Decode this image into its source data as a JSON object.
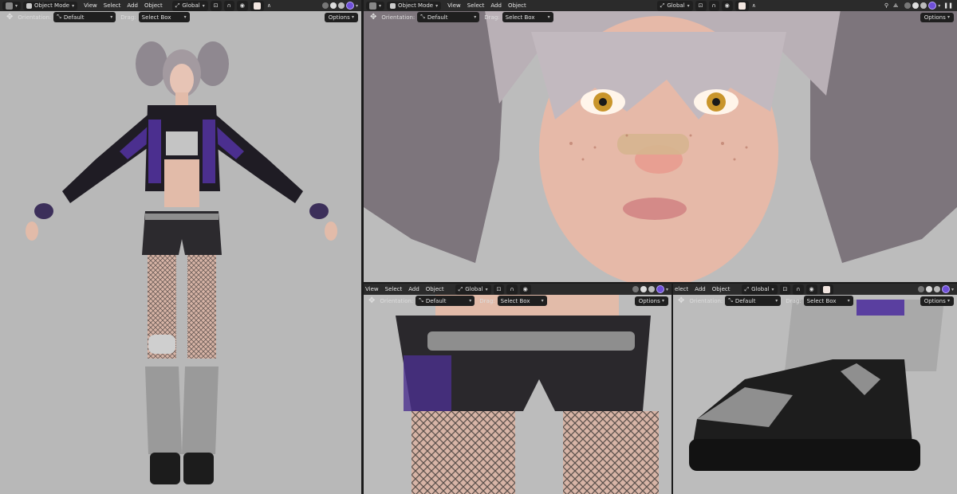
{
  "viewport_top": {
    "mode": "Object Mode",
    "menus": [
      "View",
      "Select",
      "Add",
      "Object"
    ],
    "transform": "Global",
    "orientation_label": "Orientation:",
    "orientation_value": "Default",
    "drag_label": "Drag:",
    "drag_value": "Select Box",
    "options": "Options"
  },
  "viewport_partial": {
    "menus_bl": [
      "View",
      "Select",
      "Add",
      "Object"
    ],
    "menus_br": [
      "elect",
      "Add",
      "Object"
    ],
    "transform": "Global",
    "orientation_label": "Orientation:",
    "orientation_value": "Default",
    "drag_label": "Drag:",
    "drag_value": "Select Box",
    "options": "Options"
  },
  "colors": {
    "accent": "#6f4fd8",
    "header": "#2b2b2b",
    "viewport": "#b9b9b9"
  }
}
